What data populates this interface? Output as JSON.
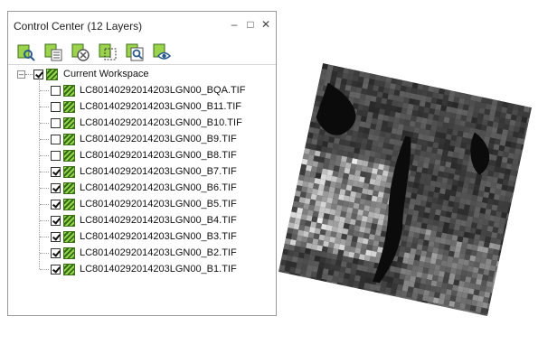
{
  "panel": {
    "title": "Control Center (12 Layers)",
    "minimize": "‒",
    "maximize": "□",
    "close": "✕"
  },
  "toolbar": {
    "buttons": [
      {
        "name": "add-layer-button",
        "icon": "add-layer-icon"
      },
      {
        "name": "layer-list-button",
        "icon": "layer-list-icon"
      },
      {
        "name": "remove-layer-button",
        "icon": "remove-layer-icon"
      },
      {
        "name": "extent-button",
        "icon": "extent-icon"
      },
      {
        "name": "zoom-layer-button",
        "icon": "zoom-layer-icon"
      },
      {
        "name": "visibility-button",
        "icon": "eye-icon"
      }
    ]
  },
  "tree": {
    "root": {
      "label": "Current Workspace",
      "checked": true,
      "expander": "–"
    },
    "layers": [
      {
        "label": "LC80140292014203LGN00_BQA.TIF",
        "checked": false
      },
      {
        "label": "LC80140292014203LGN00_B11.TIF",
        "checked": false
      },
      {
        "label": "LC80140292014203LGN00_B10.TIF",
        "checked": false
      },
      {
        "label": "LC80140292014203LGN00_B9.TIF",
        "checked": false
      },
      {
        "label": "LC80140292014203LGN00_B8.TIF",
        "checked": false
      },
      {
        "label": "LC80140292014203LGN00_B7.TIF",
        "checked": true
      },
      {
        "label": "LC80140292014203LGN00_B6.TIF",
        "checked": true
      },
      {
        "label": "LC80140292014203LGN00_B5.TIF",
        "checked": true
      },
      {
        "label": "LC80140292014203LGN00_B4.TIF",
        "checked": true
      },
      {
        "label": "LC80140292014203LGN00_B3.TIF",
        "checked": true
      },
      {
        "label": "LC80140292014203LGN00_B2.TIF",
        "checked": true
      },
      {
        "label": "LC80140292014203LGN00_B1.TIF",
        "checked": true
      }
    ]
  },
  "colors": {
    "layer_icon_light": "#9bd34c",
    "layer_icon_dark": "#2d6e14",
    "toolbar_icon": "#4a8a1c"
  }
}
